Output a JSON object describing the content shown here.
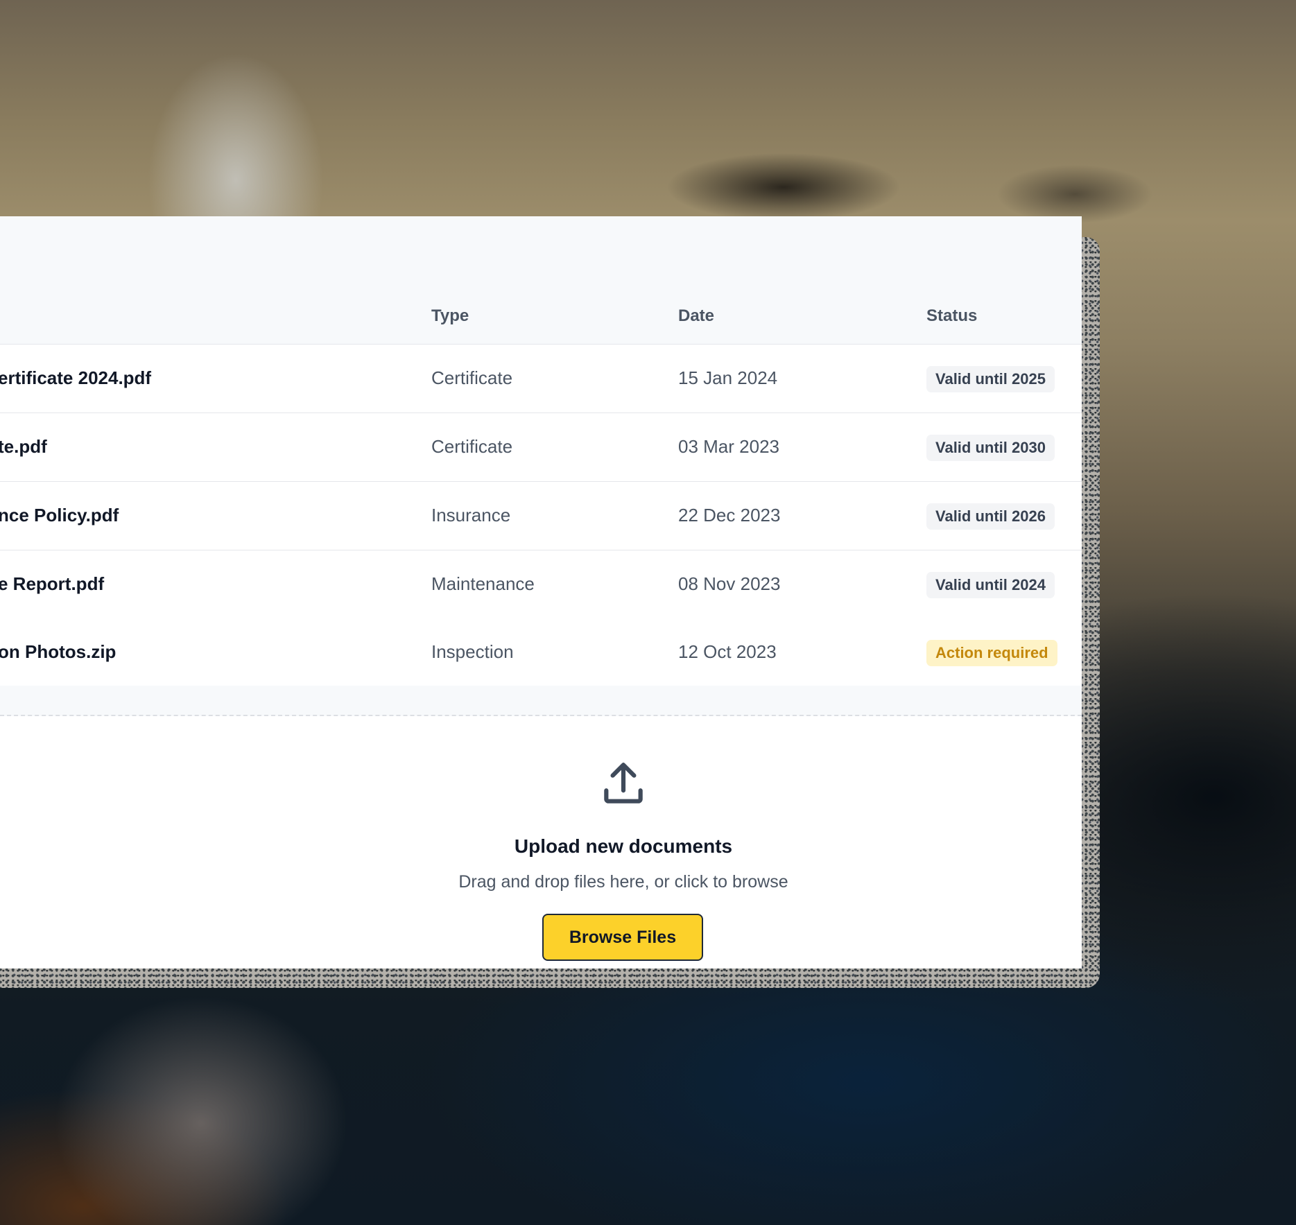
{
  "table": {
    "headers": {
      "type": "Type",
      "date": "Date",
      "status": "Status"
    },
    "rows": [
      {
        "name": "ertificate 2024.pdf",
        "type": "Certificate",
        "date": "15 Jan 2024",
        "status": "Valid until 2025",
        "status_kind": "neutral"
      },
      {
        "name": "te.pdf",
        "type": "Certificate",
        "date": "03 Mar 2023",
        "status": "Valid until 2030",
        "status_kind": "neutral"
      },
      {
        "name": "nce Policy.pdf",
        "type": "Insurance",
        "date": "22 Dec 2023",
        "status": "Valid until 2026",
        "status_kind": "neutral"
      },
      {
        "name": "e Report.pdf",
        "type": "Maintenance",
        "date": "08 Nov 2023",
        "status": "Valid until 2024",
        "status_kind": "neutral"
      },
      {
        "name": "on Photos.zip",
        "type": "Inspection",
        "date": "12 Oct 2023",
        "status": "Action required",
        "status_kind": "warning"
      }
    ]
  },
  "upload": {
    "icon": "upload-icon",
    "title": "Upload new documents",
    "subtitle": "Drag and drop files here, or click to browse",
    "button_label": "Browse Files"
  },
  "colors": {
    "accent": "#fcd12a",
    "warning_text": "#c4880c",
    "warning_bg": "#fef3c7",
    "badge_bg": "#f3f4f6"
  }
}
